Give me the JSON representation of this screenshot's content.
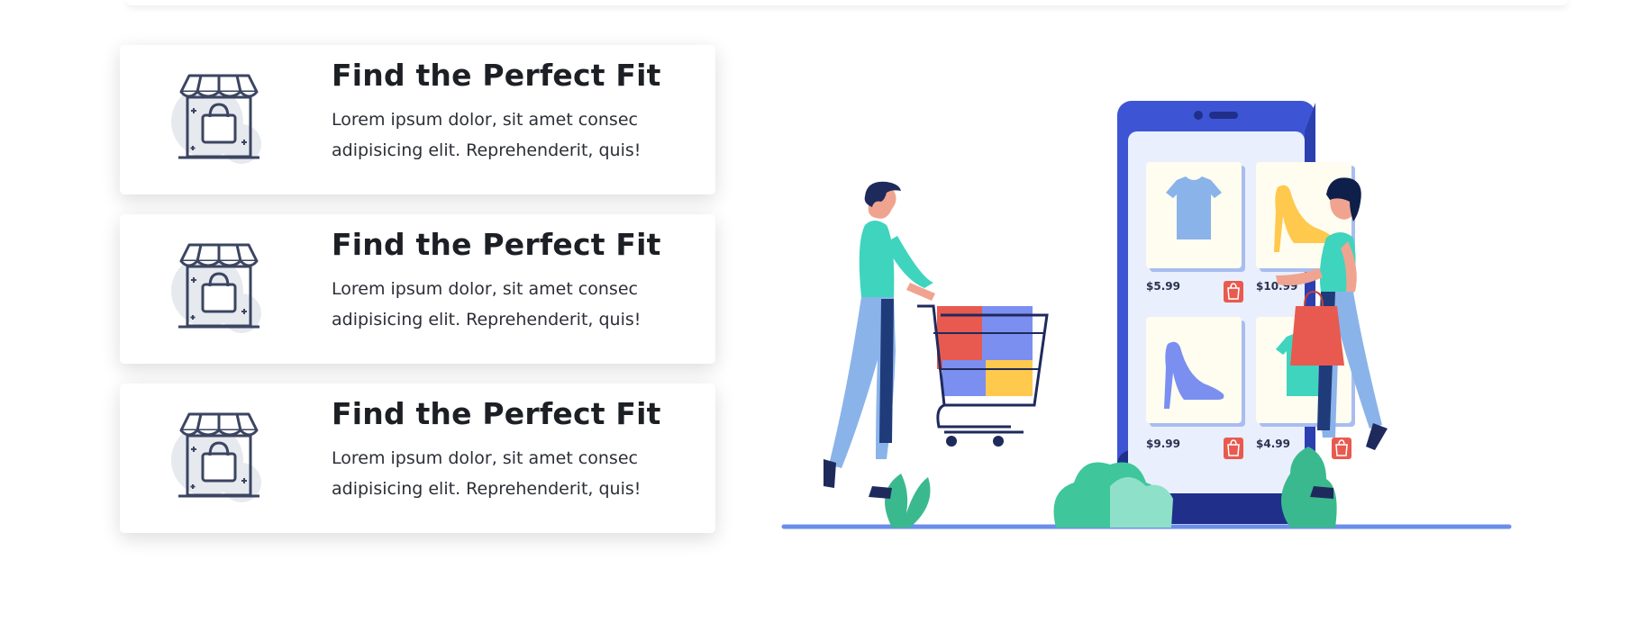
{
  "cards": [
    {
      "title": "Find the Perfect Fit",
      "text": "Lorem ipsum dolor, sit amet consec adipisicing elit. Reprehenderit, quis!",
      "icon": "storefront-bag-icon"
    },
    {
      "title": "Find the Perfect Fit",
      "text": "Lorem ipsum dolor, sit amet consec adipisicing elit. Reprehenderit, quis!",
      "icon": "storefront-bag-icon"
    },
    {
      "title": "Find the Perfect Fit",
      "text": "Lorem ipsum dolor, sit amet consec adipisicing elit. Reprehenderit, quis!",
      "icon": "storefront-bag-icon"
    }
  ],
  "illustration": {
    "name": "shopping-illustration",
    "products": [
      {
        "item": "t-shirt",
        "price": "$5.99"
      },
      {
        "item": "high-heel",
        "price": "$10.99"
      },
      {
        "item": "high-heel",
        "price": "$9.99"
      },
      {
        "item": "t-shirt",
        "price": "$4.99"
      }
    ]
  },
  "colors": {
    "title": "#1c1f24",
    "text": "#2c2f36",
    "phone": "#3d55d4",
    "phone_dark": "#1f2f8a",
    "teal": "#3fd4be",
    "red_bag": "#e85a4f",
    "blue_bag": "#7b8ff0",
    "yellow": "#ffc94d",
    "ground": "#6b8ee8"
  }
}
